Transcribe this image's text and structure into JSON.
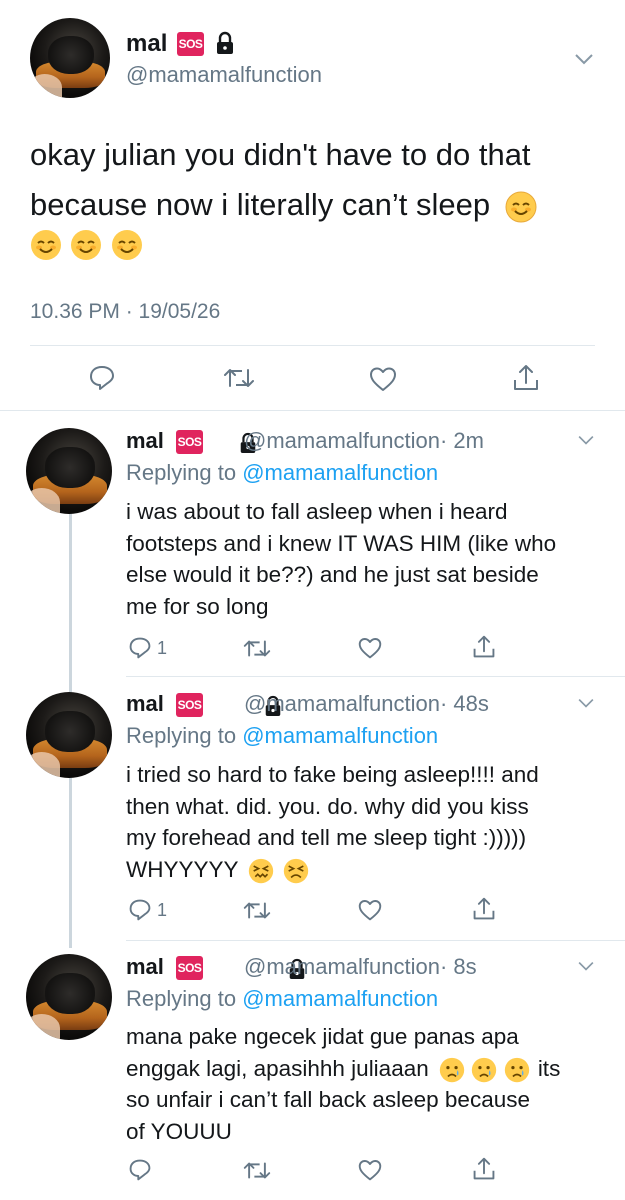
{
  "main_tweet": {
    "name": "mal",
    "badge": "SOS",
    "handle": "@mamamalfunction",
    "text_line1": "okay julian you didn't have to do that",
    "text_line2": "because now i literally can’t sleep",
    "timestamp": "10.36 PM · 19/05/26"
  },
  "replies": [
    {
      "name": "mal",
      "badge": "SOS",
      "handle": "@mamamalfunction",
      "time": "· 2m",
      "replying_prefix": "Replying to",
      "replying_to": "@mamamalfunction",
      "lines": [
        "i was about to fall asleep when i heard",
        "footsteps and i knew IT WAS HIM (like who",
        "else would it be??) and he just sat beside",
        "me for so long"
      ],
      "reply_count": "1"
    },
    {
      "name": "mal",
      "badge": "SOS",
      "handle": "@mamamalfunction",
      "time": "· 48s",
      "replying_prefix": "Replying to",
      "replying_to": "@mamamalfunction",
      "lines": [
        "i tried so hard to fake being asleep!!!! and",
        "then what. did. you. do. why did you kiss",
        "my forehead and tell me sleep tight :)))))",
        "WHYYYYY"
      ],
      "reply_count": "1"
    },
    {
      "name": "mal",
      "badge": "SOS",
      "handle": "@mamamalfunction",
      "time": "· 8s",
      "replying_prefix": "Replying to",
      "replying_to": "@mamamalfunction",
      "lines": [
        "mana pake ngecek jidat gue panas apa",
        "enggak lagi, apasihhh juliaaan",
        "so unfair i can’t fall back asleep because",
        "of YOUUU"
      ],
      "line2_tail": "its"
    }
  ],
  "icons": {
    "reply": "reply-icon",
    "retweet": "retweet-icon",
    "like": "heart-icon",
    "share": "share-icon",
    "lock": "lock-icon",
    "chevron": "chevron-down-icon"
  },
  "colors": {
    "link": "#1da1f2",
    "secondary": "#657786",
    "sos": "#e0245e"
  }
}
